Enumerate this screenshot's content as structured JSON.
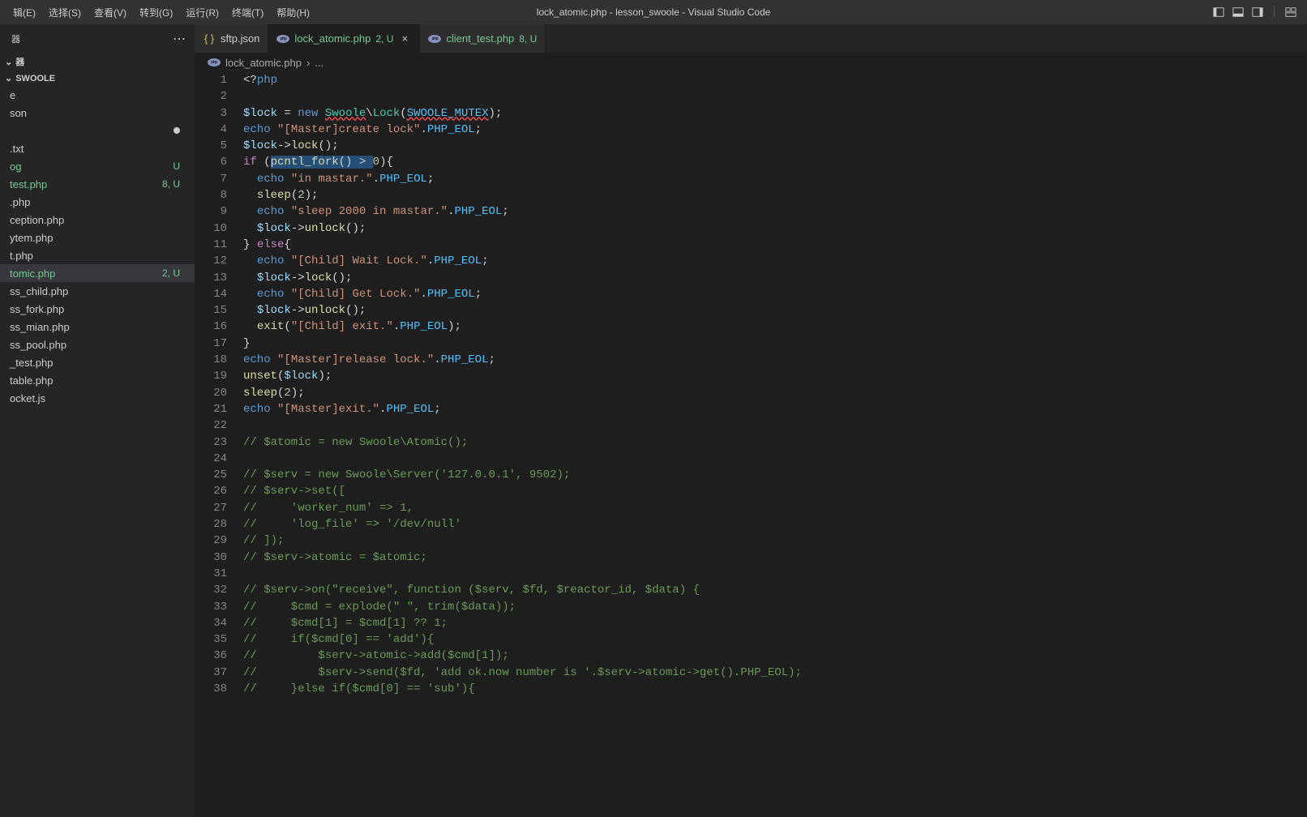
{
  "title_bar": {
    "menu": [
      "辑(E)",
      "选择(S)",
      "查看(V)",
      "转到(G)",
      "运行(R)",
      "终端(T)",
      "帮助(H)"
    ],
    "title": "lock_atomic.php - lesson_swoole - Visual Studio Code"
  },
  "sidebar": {
    "header": "器",
    "section": "器",
    "project": "SWOOLE",
    "files": [
      {
        "name": "e",
        "status": "",
        "badge": ""
      },
      {
        "name": "son",
        "status": "",
        "badge": ""
      },
      {
        "name": "",
        "status": "dot",
        "badge": ""
      },
      {
        "name": ".txt",
        "status": "",
        "badge": ""
      },
      {
        "name": "og",
        "status": "untracked",
        "badge": "U"
      },
      {
        "name": "test.php",
        "status": "untracked",
        "badge": "8, U"
      },
      {
        "name": ".php",
        "status": "",
        "badge": ""
      },
      {
        "name": "ception.php",
        "status": "",
        "badge": ""
      },
      {
        "name": "ytem.php",
        "status": "",
        "badge": ""
      },
      {
        "name": "t.php",
        "status": "",
        "badge": ""
      },
      {
        "name": "tomic.php",
        "status": "untracked",
        "badge": "2, U",
        "active": true
      },
      {
        "name": "ss_child.php",
        "status": "",
        "badge": ""
      },
      {
        "name": "ss_fork.php",
        "status": "",
        "badge": ""
      },
      {
        "name": "ss_mian.php",
        "status": "",
        "badge": ""
      },
      {
        "name": "ss_pool.php",
        "status": "",
        "badge": ""
      },
      {
        "name": "_test.php",
        "status": "",
        "badge": ""
      },
      {
        "name": "table.php",
        "status": "",
        "badge": ""
      },
      {
        "name": "ocket.js",
        "status": "",
        "badge": ""
      }
    ]
  },
  "tabs": [
    {
      "name": "sftp.json",
      "type": "json",
      "status": "",
      "badge": "",
      "active": false
    },
    {
      "name": "lock_atomic.php",
      "type": "php",
      "status": "untracked",
      "badge": "2, U",
      "active": true,
      "closable": true
    },
    {
      "name": "client_test.php",
      "type": "php",
      "status": "untracked",
      "badge": "8, U",
      "active": false
    }
  ],
  "breadcrumb": {
    "file": "lock_atomic.php",
    "sep": "›",
    "rest": "..."
  },
  "code": {
    "start_line": 1,
    "lines": [
      {
        "n": 1,
        "html": "<span class='pn'>&lt;?</span><span class='k2'>php</span>"
      },
      {
        "n": 2,
        "html": ""
      },
      {
        "n": 3,
        "html": "<span class='var'>$lock</span> <span class='pn'>=</span> <span class='k2'>new</span> <span class='cls squiggle'>Swoole</span><span class='pn'>\\</span><span class='cls'>Lock</span><span class='pn'>(</span><span class='const squiggle'>SWOOLE_MUTEX</span><span class='pn'>);</span>"
      },
      {
        "n": 4,
        "html": "<span class='k2'>echo</span> <span class='str'>\"[Master]create lock\"</span><span class='pn'>.</span><span class='const'>PHP_EOL</span><span class='pn'>;</span>"
      },
      {
        "n": 5,
        "html": "<span class='var'>$lock</span><span class='pn'>-&gt;</span><span class='fn'>lock</span><span class='pn'>();</span>"
      },
      {
        "n": 6,
        "html": "<span class='k'>if</span> <span class='pn'>(</span><span class='sel'><span class='fn'>pcntl_fork</span><span class='pn'>()</span> <span class='pn'>&gt;</span> </span><span class='num'>0</span><span class='pn'>){</span>"
      },
      {
        "n": 7,
        "html": "  <span class='k2'>echo</span> <span class='str'>\"in mastar.\"</span><span class='pn'>.</span><span class='const'>PHP_EOL</span><span class='pn'>;</span>"
      },
      {
        "n": 8,
        "html": "  <span class='fn'>sleep</span><span class='pn'>(</span><span class='num'>2</span><span class='pn'>);</span>"
      },
      {
        "n": 9,
        "html": "  <span class='k2'>echo</span> <span class='str'>\"sleep 2000 in mastar.\"</span><span class='pn'>.</span><span class='const'>PHP_EOL</span><span class='pn'>;</span>"
      },
      {
        "n": 10,
        "html": "  <span class='var'>$lock</span><span class='pn'>-&gt;</span><span class='fn'>unlock</span><span class='pn'>();</span>"
      },
      {
        "n": 11,
        "html": "<span class='pn'>}</span> <span class='k'>else</span><span class='pn'>{</span>"
      },
      {
        "n": 12,
        "html": "  <span class='k2'>echo</span> <span class='str'>\"[Child] Wait Lock.\"</span><span class='pn'>.</span><span class='const'>PHP_EOL</span><span class='pn'>;</span>"
      },
      {
        "n": 13,
        "html": "  <span class='var'>$lock</span><span class='pn'>-&gt;</span><span class='fn'>lock</span><span class='pn'>();</span>"
      },
      {
        "n": 14,
        "html": "  <span class='k2'>echo</span> <span class='str'>\"[Child] Get Lock.\"</span><span class='pn'>.</span><span class='const'>PHP_EOL</span><span class='pn'>;</span>"
      },
      {
        "n": 15,
        "html": "  <span class='var'>$lock</span><span class='pn'>-&gt;</span><span class='fn'>unlock</span><span class='pn'>();</span>"
      },
      {
        "n": 16,
        "html": "  <span class='fn'>exit</span><span class='pn'>(</span><span class='str'>\"[Child] exit.\"</span><span class='pn'>.</span><span class='const'>PHP_EOL</span><span class='pn'>);</span>"
      },
      {
        "n": 17,
        "html": "<span class='pn'>}</span>"
      },
      {
        "n": 18,
        "html": "<span class='k2'>echo</span> <span class='str'>\"[Master]release lock.\"</span><span class='pn'>.</span><span class='const'>PHP_EOL</span><span class='pn'>;</span>"
      },
      {
        "n": 19,
        "html": "<span class='fn'>unset</span><span class='pn'>(</span><span class='var'>$lock</span><span class='pn'>);</span>"
      },
      {
        "n": 20,
        "html": "<span class='fn'>sleep</span><span class='pn'>(</span><span class='num'>2</span><span class='pn'>);</span>"
      },
      {
        "n": 21,
        "html": "<span class='k2'>echo</span> <span class='str'>\"[Master]exit.\"</span><span class='pn'>.</span><span class='const'>PHP_EOL</span><span class='pn'>;</span>"
      },
      {
        "n": 22,
        "html": ""
      },
      {
        "n": 23,
        "html": "<span class='cmt'>// $atomic = new Swoole\\Atomic();</span>"
      },
      {
        "n": 24,
        "html": ""
      },
      {
        "n": 25,
        "html": "<span class='cmt'>// $serv = new Swoole\\Server('127.0.0.1', 9502);</span>"
      },
      {
        "n": 26,
        "html": "<span class='cmt'>// $serv-&gt;set([</span>"
      },
      {
        "n": 27,
        "html": "<span class='cmt'>//     'worker_num' =&gt; 1,</span>"
      },
      {
        "n": 28,
        "html": "<span class='cmt'>//     'log_file' =&gt; '/dev/null'</span>"
      },
      {
        "n": 29,
        "html": "<span class='cmt'>// ]);</span>"
      },
      {
        "n": 30,
        "html": "<span class='cmt'>// $serv-&gt;atomic = $atomic;</span>"
      },
      {
        "n": 31,
        "html": ""
      },
      {
        "n": 32,
        "html": "<span class='cmt'>// $serv-&gt;on(\"receive\", function ($serv, $fd, $reactor_id, $data) {</span>"
      },
      {
        "n": 33,
        "html": "<span class='cmt'>//     $cmd = explode(\" \", trim($data));</span>"
      },
      {
        "n": 34,
        "html": "<span class='cmt'>//     $cmd[1] = $cmd[1] ?? 1;</span>"
      },
      {
        "n": 35,
        "html": "<span class='cmt'>//     if($cmd[0] == 'add'){</span>"
      },
      {
        "n": 36,
        "html": "<span class='cmt'>//         $serv-&gt;atomic-&gt;add($cmd[1]);</span>"
      },
      {
        "n": 37,
        "html": "<span class='cmt'>//         $serv-&gt;send($fd, 'add ok.now number is '.$serv-&gt;atomic-&gt;get().PHP_EOL);</span>"
      },
      {
        "n": 38,
        "html": "<span class='cmt'>//     }else if($cmd[0] == 'sub'){</span>"
      }
    ]
  }
}
